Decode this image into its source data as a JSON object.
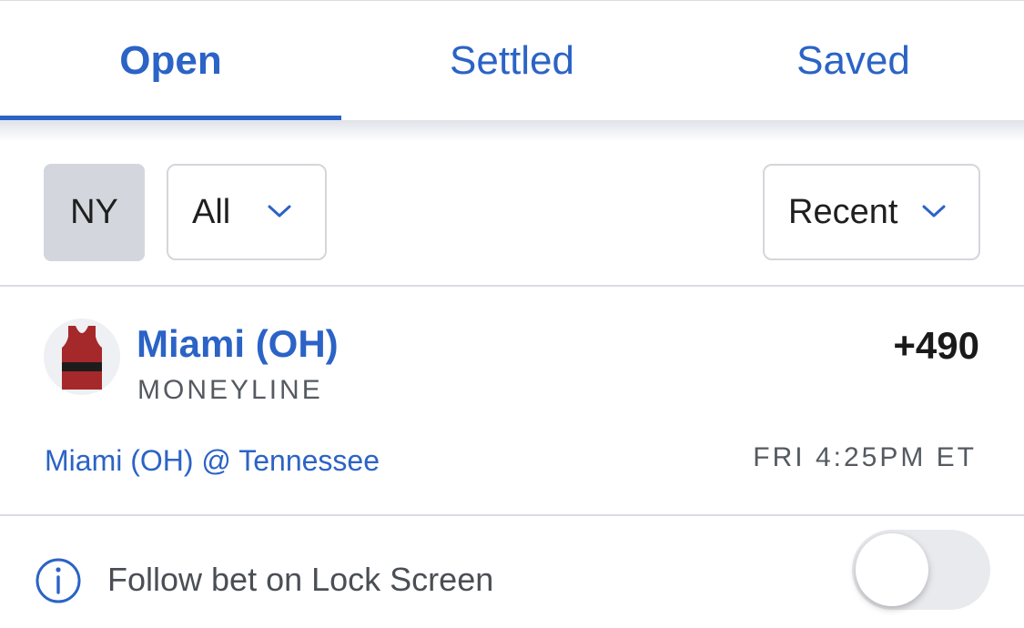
{
  "tabs": [
    {
      "label": "Open",
      "active": true
    },
    {
      "label": "Settled",
      "active": false
    },
    {
      "label": "Saved",
      "active": false
    }
  ],
  "filters": {
    "state": "NY",
    "bet_filter": {
      "selected": "All"
    },
    "sort": {
      "selected": "Recent"
    }
  },
  "bet": {
    "team": "Miami (OH)",
    "market": "MONEYLINE",
    "odds": "+490",
    "matchup": "Miami (OH) @ Tennessee",
    "game_time": "FRI 4:25PM ET",
    "team_icon": "jersey-icon",
    "jersey_colors": {
      "body": "#a5282a",
      "stripe": "#1c1c1c"
    }
  },
  "follow": {
    "label": "Follow bet on Lock Screen",
    "enabled": false
  },
  "colors": {
    "accent": "#2b63c6",
    "text_primary": "#1a1a1a",
    "text_secondary": "#555a61",
    "divider": "#dadce1"
  }
}
